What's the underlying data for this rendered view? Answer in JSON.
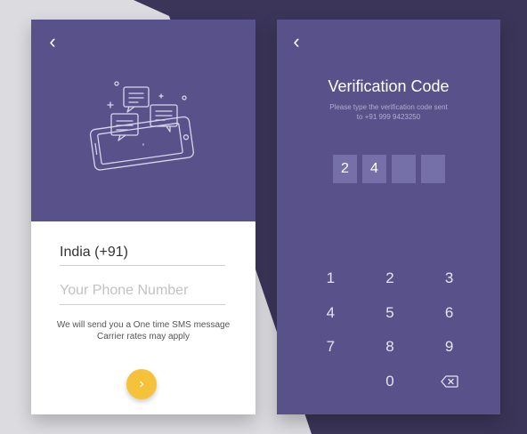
{
  "colors": {
    "background_light": "#dcdce0",
    "background_dark": "#3b3659",
    "card_purple": "#58518a",
    "code_box": "#7670a8",
    "accent_yellow": "#f5c23a"
  },
  "phone_screen": {
    "back_icon": "chevron-left-icon",
    "back_glyph": "‹",
    "illustration_icon": "phone-chat-bubbles-icon",
    "country_value": "India (+91)",
    "phone_placeholder": "Your Phone Number",
    "phone_value": "",
    "info_line1": "We will send you a One time SMS message",
    "info_line2": "Carrier rates may apply",
    "next_icon": "chevron-right-icon",
    "next_glyph": "›"
  },
  "verify_screen": {
    "back_icon": "chevron-left-icon",
    "back_glyph": "‹",
    "title": "Verification Code",
    "subtitle_line1": "Please type the verification code sent",
    "subtitle_line2": "to +91 999 9423250",
    "code_digits": [
      "2",
      "4",
      "",
      ""
    ],
    "keypad_keys": [
      "1",
      "2",
      "3",
      "4",
      "5",
      "6",
      "7",
      "8",
      "9",
      "",
      "0",
      "⌫"
    ],
    "backspace_icon": "backspace-icon"
  }
}
